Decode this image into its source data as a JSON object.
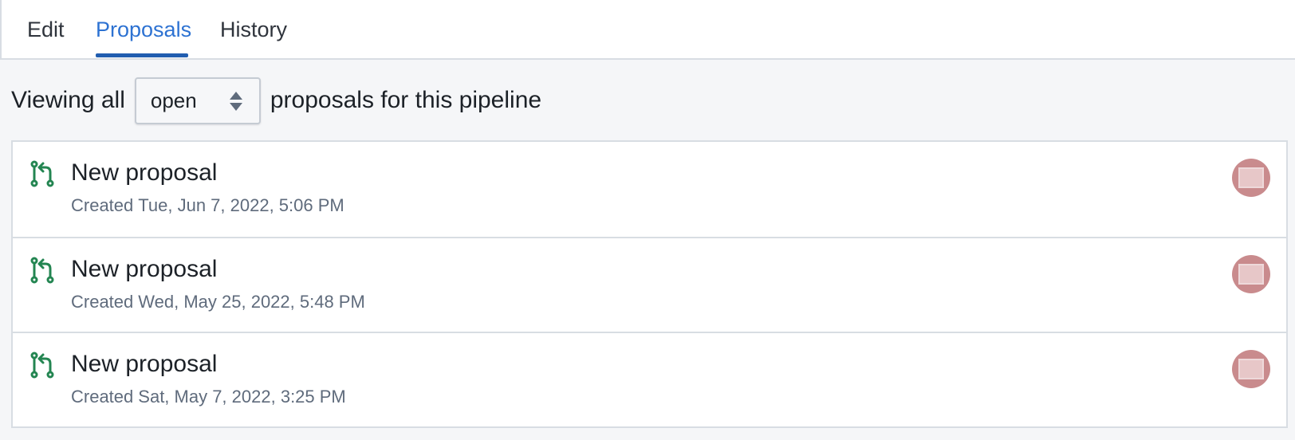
{
  "tabs": {
    "edit": "Edit",
    "proposals": "Proposals",
    "history": "History"
  },
  "filter": {
    "prefix": "Viewing all",
    "selected": "open",
    "suffix": "proposals for this pipeline"
  },
  "proposals": [
    {
      "title": "New proposal",
      "created_label": "Created",
      "created": "Tue, Jun 7, 2022, 5:06 PM"
    },
    {
      "title": "New proposal",
      "created_label": "Created",
      "created": "Wed, May 25, 2022, 5:48 PM"
    },
    {
      "title": "New proposal",
      "created_label": "Created",
      "created": "Sat, May 7, 2022, 3:25 PM"
    }
  ],
  "colors": {
    "accent": "#2d72d2",
    "merge_icon": "#238551",
    "avatar": "#c98b8d"
  },
  "icons": {
    "row": "git-pull-icon",
    "select": "double-caret-vertical-icon"
  }
}
